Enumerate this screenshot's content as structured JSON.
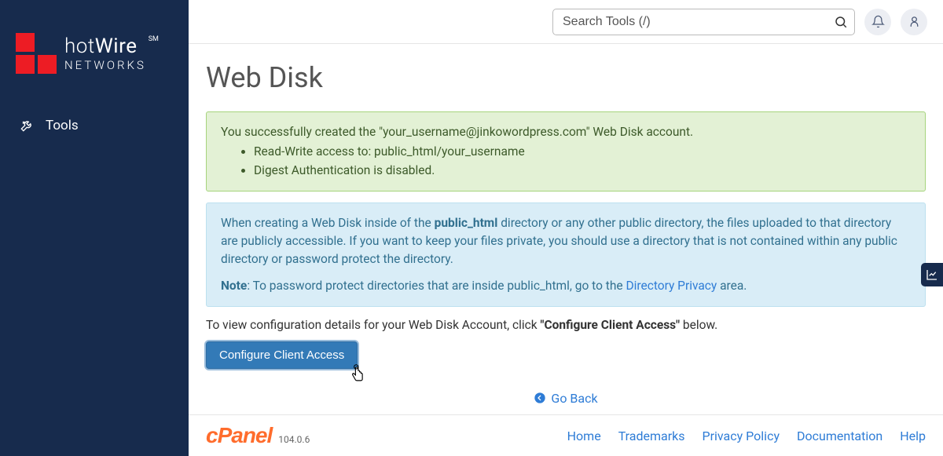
{
  "sidebar": {
    "brand_line1_thin": "hot",
    "brand_line1_bold": "Wire",
    "brand_sm": "SM",
    "brand_line2": "NETWORKS",
    "items": [
      {
        "label": "Tools"
      }
    ]
  },
  "topbar": {
    "search_placeholder": "Search Tools (/)"
  },
  "page": {
    "title": "Web Disk",
    "success": {
      "message": "You successfully created the \"your_username@jinkowordpress.com\" Web Disk account.",
      "bullets": [
        "Read-Write access to: public_html/your_username",
        "Digest Authentication is disabled."
      ]
    },
    "info": {
      "para_before_bold": "When creating a Web Disk inside of the ",
      "para_bold": "public_html",
      "para_after_bold": " directory or any other public directory, the files uploaded to that directory are publicly accessible. If you want to keep your files private, you should use a directory that is not contained within any public directory or password protect the directory.",
      "note_bold": "Note",
      "note_before_link": ": To password protect directories that are inside public_html, go to the ",
      "note_link": "Directory Privacy",
      "note_after_link": " area."
    },
    "view_text_before": "To view configuration details for your Web Disk Account, click ",
    "view_text_bold": "\"Configure Client Access\"",
    "view_text_after": " below.",
    "configure_btn": "Configure Client Access",
    "go_back": "Go Back"
  },
  "footer": {
    "brand": "cPanel",
    "version": "104.0.6",
    "links": [
      "Home",
      "Trademarks",
      "Privacy Policy",
      "Documentation",
      "Help"
    ]
  }
}
